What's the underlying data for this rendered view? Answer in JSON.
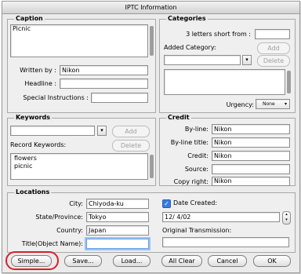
{
  "window": {
    "title": "IPTC Information"
  },
  "caption": {
    "legend": "Caption",
    "text": "Picnic",
    "written_by_label": "Written by :",
    "written_by_value": "Nikon",
    "headline_label": "Headline :",
    "headline_value": "",
    "special_instructions_label": "Special Instructions :",
    "special_instructions_value": ""
  },
  "categories": {
    "legend": "Categories",
    "short_from_label": "3 letters short from :",
    "short_from_value": "",
    "added_category_label": "Added Category:",
    "add_label": "Add",
    "delete_label": "Delete",
    "urgency_label": "Urgency:",
    "urgency_value": "None"
  },
  "keywords": {
    "legend": "Keywords",
    "input_value": "",
    "add_label": "Add",
    "delete_label": "Delete",
    "record_label": "Record Keywords:",
    "items": [
      "flowers",
      "picnic"
    ]
  },
  "credit": {
    "legend": "Credit",
    "byline_label": "By-line:",
    "byline_value": "Nikon",
    "byline_title_label": "By-line title:",
    "byline_title_value": "Nikon",
    "credit_label": "Credit:",
    "credit_value": "Nikon",
    "source_label": "Source:",
    "source_value": "",
    "copyright_label": "Copy right:",
    "copyright_value": "Nikon"
  },
  "locations": {
    "legend": "Locations",
    "city_label": "City:",
    "city_value": "Chiyoda-ku",
    "state_label": "State/Province:",
    "state_value": "Tokyo",
    "country_label": "Country:",
    "country_value": "Japan",
    "title_label": "Title(Object Name):",
    "title_value": ""
  },
  "date": {
    "checkbox_label": "Date Created:",
    "checked": true,
    "date_value": "12/  4/02",
    "original_transmission_label": "Original Transmission:",
    "original_transmission_value": ""
  },
  "buttons": {
    "simple": "Simple...",
    "save": "Save...",
    "load": "Load...",
    "all_clear": "All Clear",
    "cancel": "Cancel",
    "ok": "OK"
  },
  "colors": {
    "highlight": "#d81f2a",
    "checkbox": "#3b7be0"
  }
}
